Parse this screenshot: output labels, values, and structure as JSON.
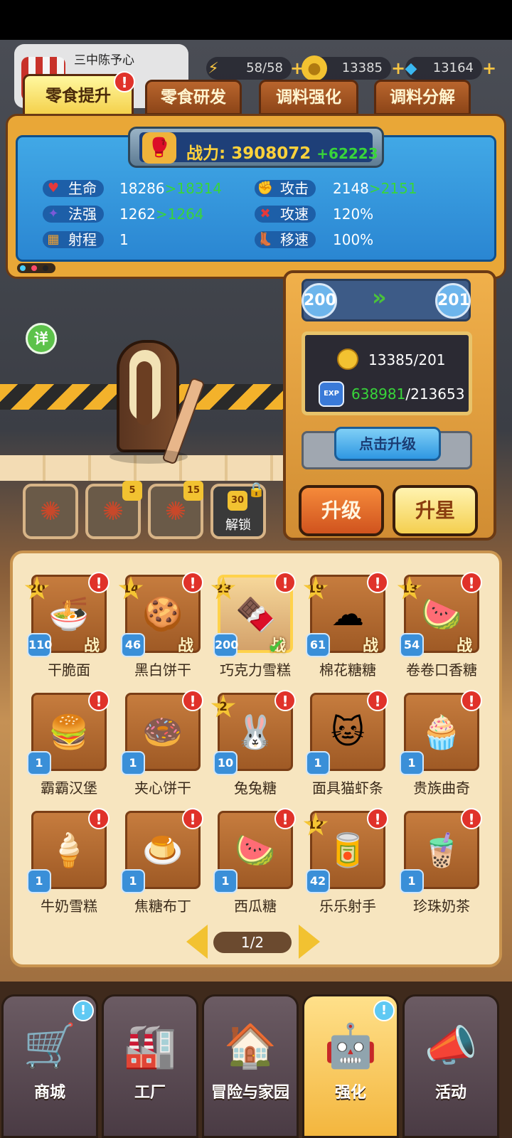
{
  "profile": {
    "name": "三中陈予心"
  },
  "resources": {
    "energy": "58/58",
    "coins": "13385",
    "diamonds": "13164",
    "plus": "+"
  },
  "tabs": [
    {
      "label": "零食提升",
      "badge": "!"
    },
    {
      "label": "零食研发"
    },
    {
      "label": "调料强化"
    },
    {
      "label": "调料分解"
    }
  ],
  "power": {
    "label": "战力:",
    "value": "3908072",
    "delta": "+62223"
  },
  "stats": {
    "hp": {
      "label": "生命",
      "value": "18286",
      "arrow": ">",
      "next": "18314"
    },
    "atk": {
      "label": "攻击",
      "value": "2148",
      "arrow": ">",
      "next": "2151"
    },
    "magic": {
      "label": "法强",
      "value": "1262",
      "arrow": ">",
      "next": "1264"
    },
    "aspd": {
      "label": "攻速",
      "value": "120%"
    },
    "range": {
      "label": "射程",
      "value": "1"
    },
    "mspd": {
      "label": "移速",
      "value": "100%"
    }
  },
  "detail_label": "详",
  "upgrade": {
    "from_level": "200",
    "to_level": "201",
    "coin_cost": "13385/201",
    "exp_have": "638981",
    "exp_need": "/213653",
    "exp_icon_label": "EXP",
    "click_label": "点击升级",
    "level_up_label": "升级",
    "star_up_label": "升星"
  },
  "skills": [
    {
      "level": ""
    },
    {
      "level": "5"
    },
    {
      "level": "15"
    },
    {
      "level": "30",
      "label": "解锁"
    }
  ],
  "cards": [
    {
      "name": "干脆面",
      "star": "20",
      "level": "110",
      "tag": "战",
      "art": "🍜"
    },
    {
      "name": "黑白饼干",
      "star": "14",
      "level": "46",
      "tag": "战",
      "art": "🍪"
    },
    {
      "name": "巧克力雪糕",
      "star": "23",
      "level": "200",
      "tag": "战",
      "art": "🍫",
      "selected": true
    },
    {
      "name": "棉花糖糖",
      "star": "19",
      "level": "61",
      "tag": "战",
      "art": "☁"
    },
    {
      "name": "卷卷口香糖",
      "star": "13",
      "level": "54",
      "tag": "战",
      "art": "🍉"
    },
    {
      "name": "霸霸汉堡",
      "star": "",
      "level": "1",
      "tag": "",
      "art": "🍔"
    },
    {
      "name": "夹心饼干",
      "star": "",
      "level": "1",
      "tag": "",
      "art": "🍩"
    },
    {
      "name": "兔兔糖",
      "star": "2",
      "level": "10",
      "tag": "",
      "art": "🐰"
    },
    {
      "name": "面具猫虾条",
      "star": "",
      "level": "1",
      "tag": "",
      "art": "🐱"
    },
    {
      "name": "贵族曲奇",
      "star": "",
      "level": "1",
      "tag": "",
      "art": "🧁"
    },
    {
      "name": "牛奶雪糕",
      "star": "",
      "level": "1",
      "tag": "",
      "art": "🍦"
    },
    {
      "name": "焦糖布丁",
      "star": "",
      "level": "1",
      "tag": "",
      "art": "🍮"
    },
    {
      "name": "西瓜糖",
      "star": "",
      "level": "1",
      "tag": "",
      "art": "🍉"
    },
    {
      "name": "乐乐射手",
      "star": "12",
      "level": "42",
      "tag": "",
      "art": "🥫"
    },
    {
      "name": "珍珠奶茶",
      "star": "",
      "level": "1",
      "tag": "",
      "art": "🧋"
    }
  ],
  "badge_text": "!",
  "pager": "1/2",
  "nav": [
    {
      "label": "商城",
      "art": "🛒",
      "bubble": "!"
    },
    {
      "label": "工厂",
      "art": "🏭"
    },
    {
      "label": "冒险与家园",
      "art": "🏠"
    },
    {
      "label": "强化",
      "art": "🤖",
      "bubble": "!",
      "active": true
    },
    {
      "label": "活动",
      "art": "📣"
    }
  ]
}
